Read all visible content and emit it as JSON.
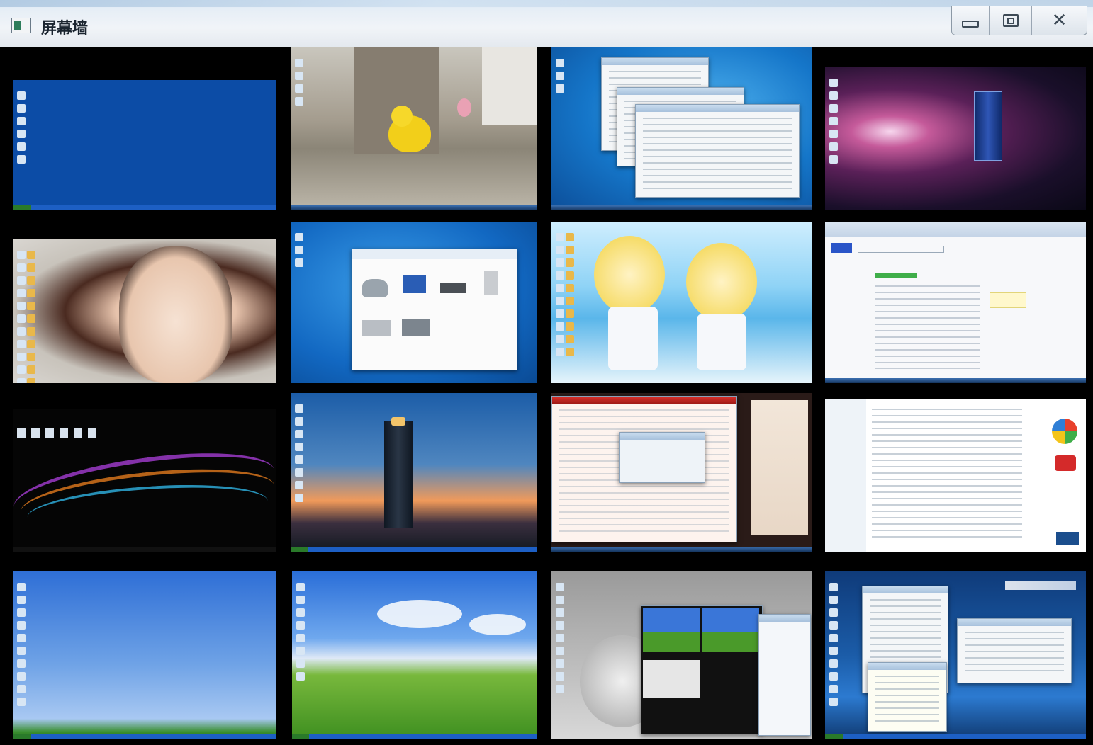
{
  "window": {
    "title": "屏幕墙"
  },
  "controls": {
    "minimize": "minimize-icon",
    "maximize": "maximize-icon",
    "close": "close-icon"
  },
  "tiles": [
    "screen-1",
    "screen-2",
    "screen-3",
    "screen-4",
    "screen-5",
    "screen-6",
    "screen-7",
    "screen-8",
    "screen-9",
    "screen-10",
    "screen-11",
    "screen-12",
    "screen-13",
    "screen-14",
    "screen-15",
    "screen-16"
  ],
  "colors": {
    "titlebar": "#e6eef6",
    "grid_bg": "#000000",
    "xp_blue": "#0a4aa0"
  }
}
